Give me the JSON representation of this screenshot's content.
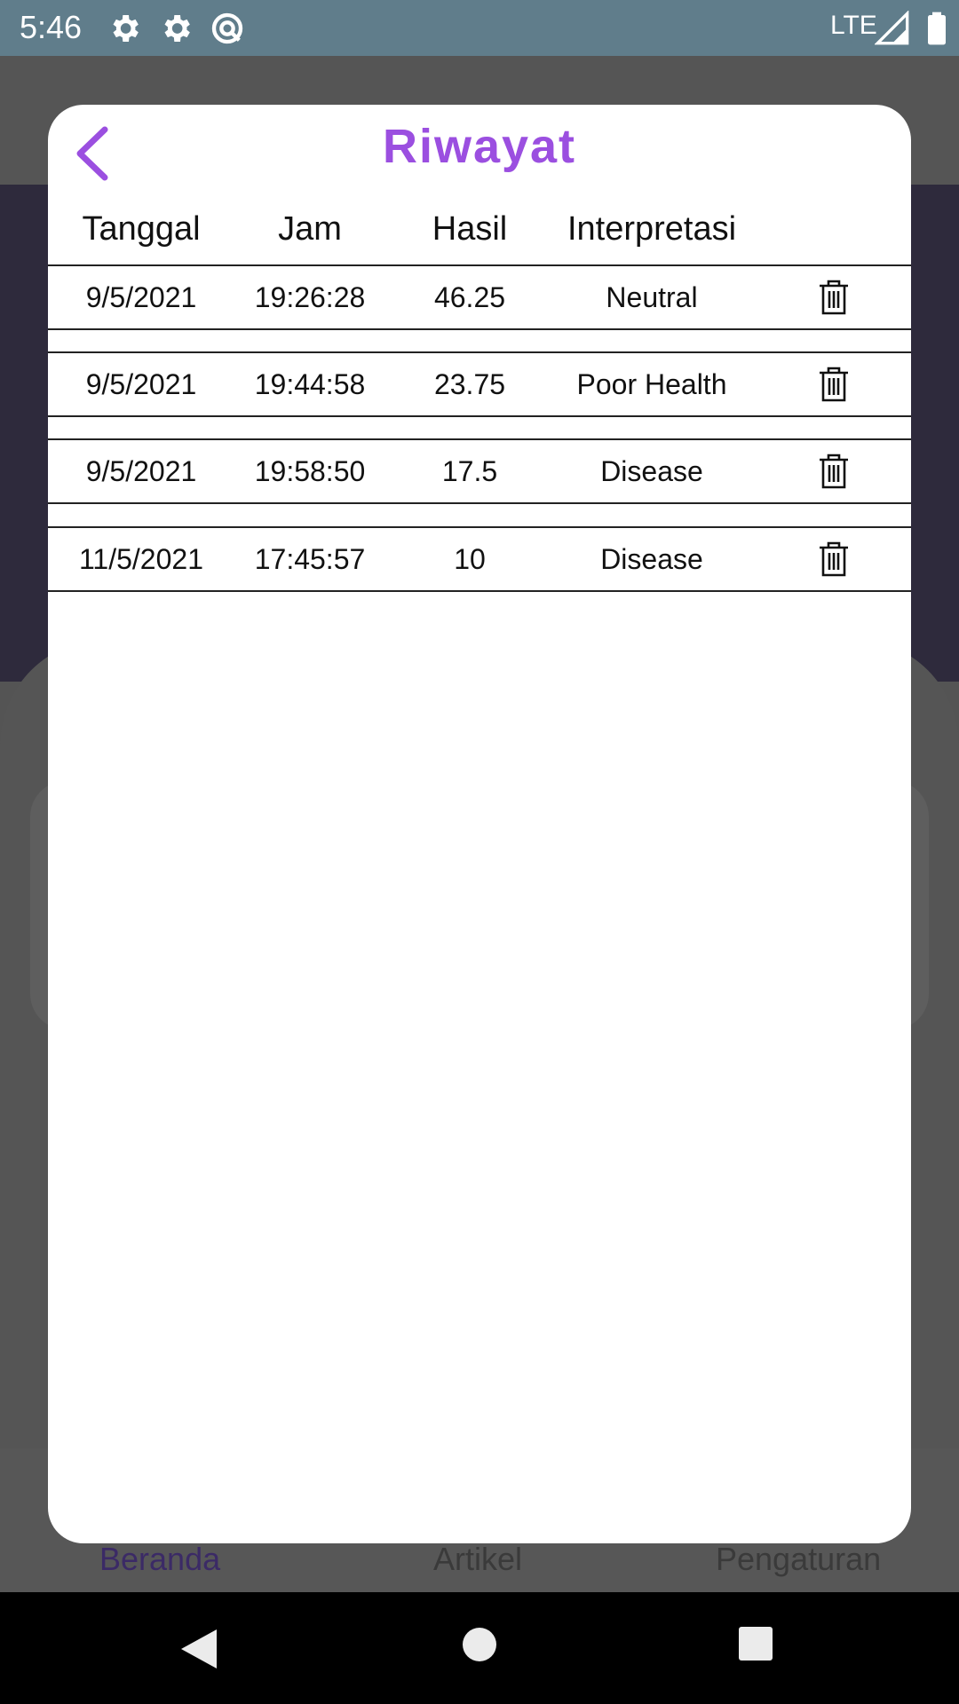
{
  "status_bar": {
    "time": "5:46",
    "network": "LTE",
    "icons": [
      "settings-icon",
      "settings-icon",
      "sync-icon",
      "signal-icon",
      "battery-icon"
    ]
  },
  "dialog": {
    "title": "Riwayat",
    "back_icon": "chevron-left-icon",
    "columns": [
      "Tanggal",
      "Jam",
      "Hasil",
      "Interpretasi"
    ],
    "rows": [
      {
        "tanggal": "9/5/2021",
        "jam": "19:26:28",
        "hasil": "46.25",
        "interpretasi": "Neutral"
      },
      {
        "tanggal": "9/5/2021",
        "jam": "19:44:58",
        "hasil": "23.75",
        "interpretasi": "Poor Health"
      },
      {
        "tanggal": "9/5/2021",
        "jam": "19:58:50",
        "hasil": "17.5",
        "interpretasi": "Disease"
      },
      {
        "tanggal": "11/5/2021",
        "jam": "17:45:57",
        "hasil": "10",
        "interpretasi": "Disease"
      }
    ],
    "delete_icon": "trash-icon"
  },
  "bottom_nav": {
    "items": [
      "Beranda",
      "Artikel",
      "Pengaturan"
    ],
    "active": "Beranda"
  },
  "colors": {
    "accent": "#9b4fe0",
    "status_bar": "#607d8b",
    "active_nav": "#3b2a66"
  }
}
